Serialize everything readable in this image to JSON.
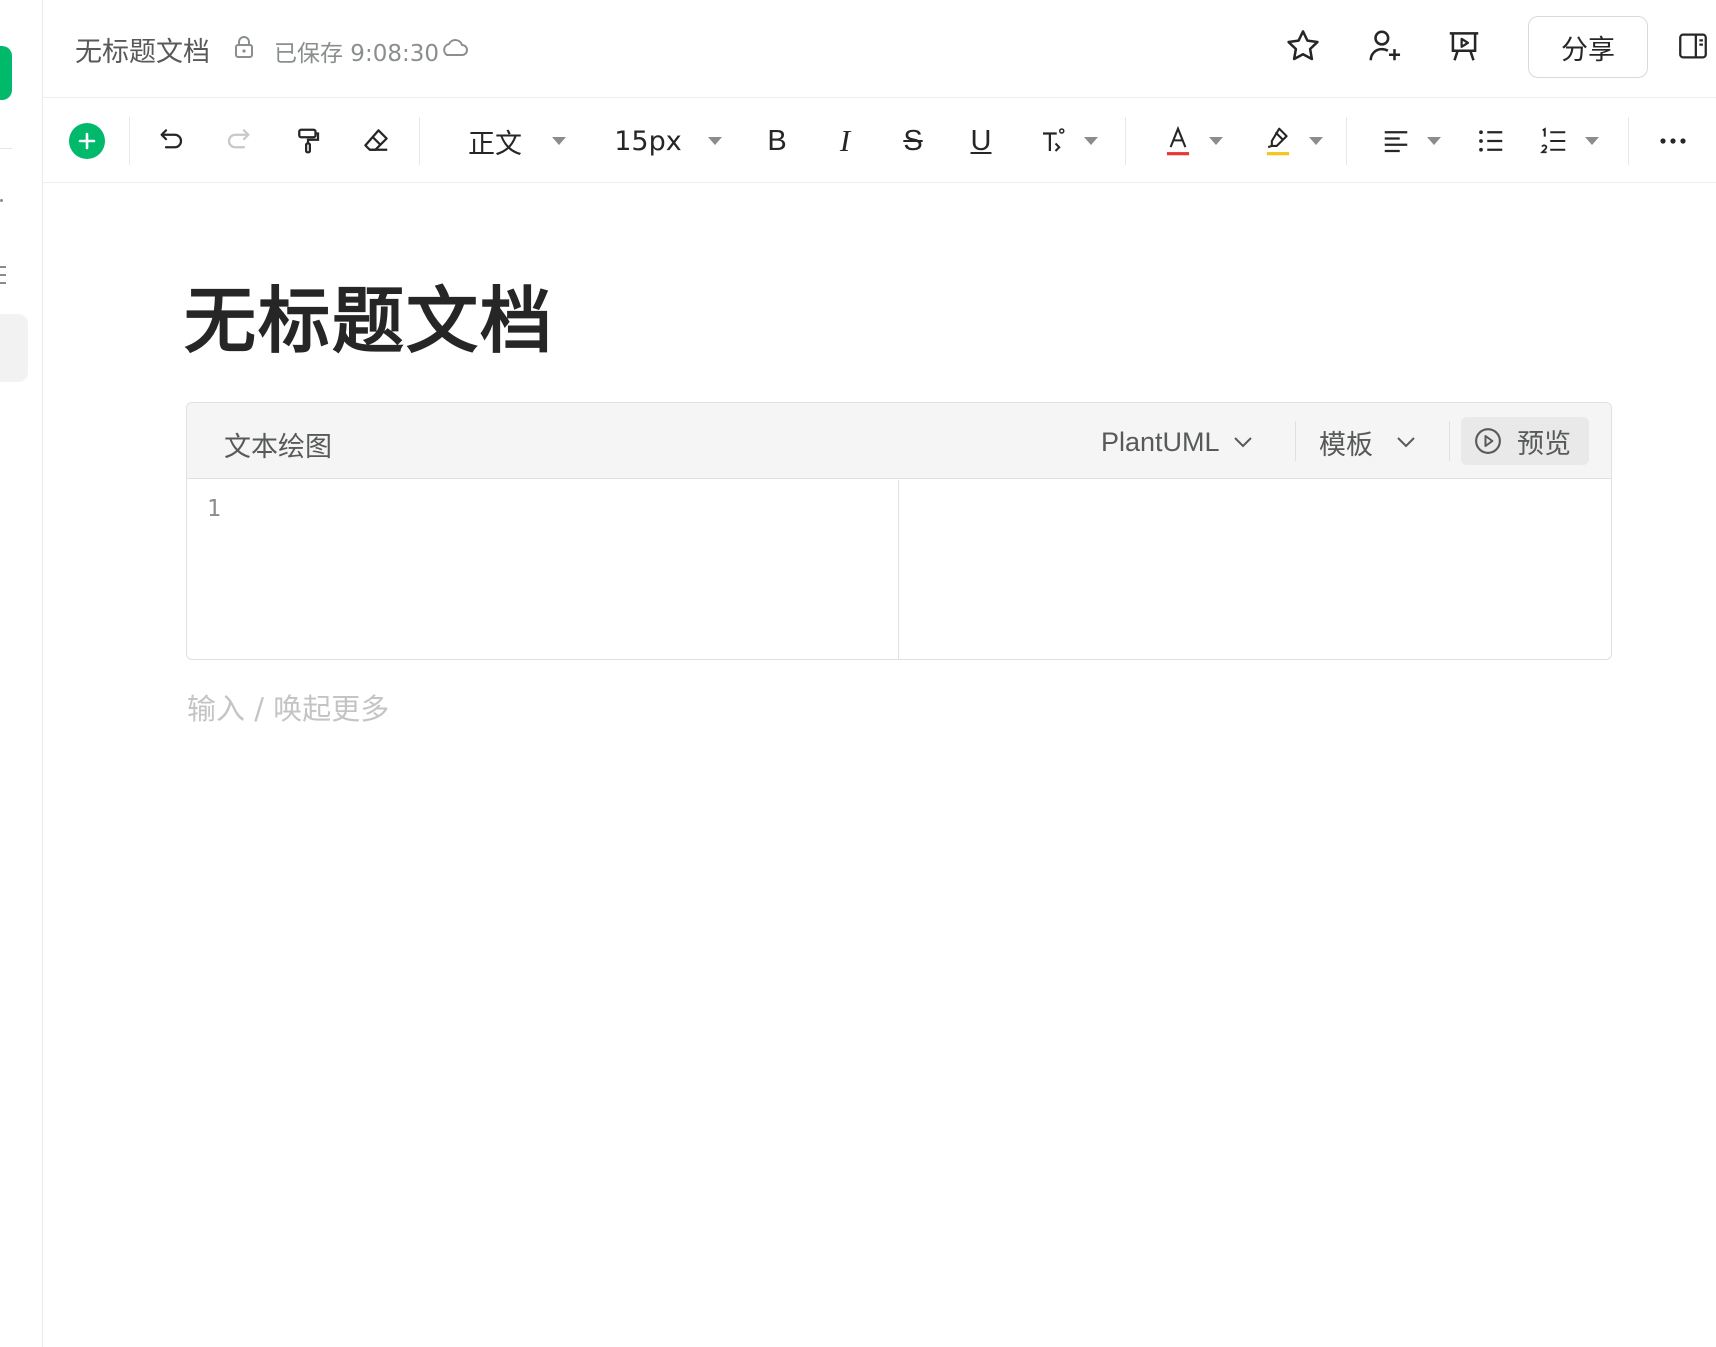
{
  "header": {
    "doc_title": "无标题文档",
    "saved_status": "已保存 9:08:30",
    "share_label": "分享",
    "icons": [
      "lock-icon",
      "cloud-icon",
      "star-icon",
      "add-user-icon",
      "presentation-icon",
      "panel-icon"
    ]
  },
  "toolbar": {
    "paragraph_style": "正文",
    "font_size": "15px",
    "bold": "B",
    "italic": "I",
    "strike": "S",
    "underline": "U",
    "icons": [
      "insert-plus-icon",
      "undo-icon",
      "redo-icon",
      "format-painter-icon",
      "eraser-icon",
      "text-style-icon",
      "font-color-icon",
      "highlight-icon",
      "align-left-icon",
      "bullet-list-icon",
      "numbered-list-icon",
      "more-icon"
    ],
    "font_color_accent": "#e53935",
    "highlight_accent": "#f5c518",
    "brand_color": "#00b96b"
  },
  "document": {
    "heading": "无标题文档",
    "placeholder": "输入 / 唤起更多"
  },
  "diagram_block": {
    "title": "文本绘图",
    "language": "PlantUML",
    "template_label": "模板",
    "preview_label": "预览",
    "line_numbers": [
      "1"
    ]
  }
}
